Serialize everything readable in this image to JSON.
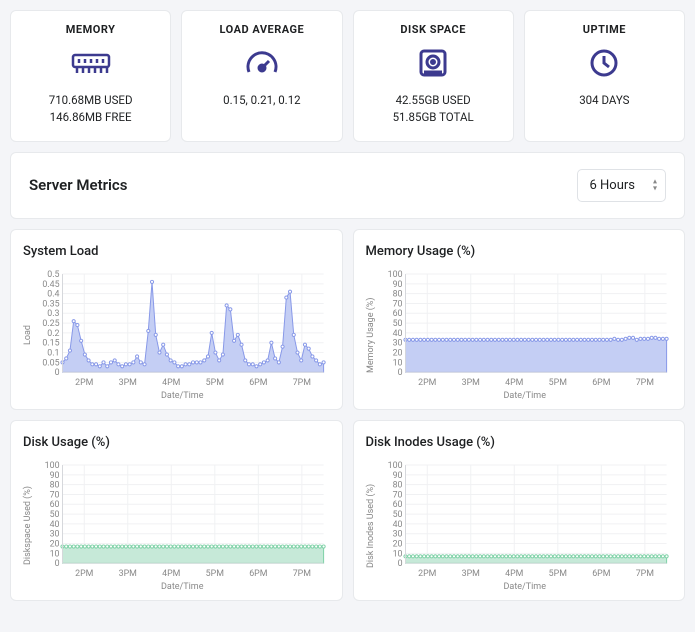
{
  "cards": {
    "memory": {
      "title": "MEMORY",
      "line1": "710.68MB USED",
      "line2": "146.86MB FREE"
    },
    "load": {
      "title": "LOAD AVERAGE",
      "line1": "0.15, 0.21, 0.12"
    },
    "disk": {
      "title": "DISK SPACE",
      "line1": "42.55GB USED",
      "line2": "51.85GB TOTAL"
    },
    "uptime": {
      "title": "UPTIME",
      "line1": "304 DAYS"
    }
  },
  "metrics": {
    "title": "Server Metrics",
    "range": "6 Hours"
  },
  "charts": {
    "system_load": {
      "title": "System Load",
      "ylabel": "Load",
      "xlabel": "Date/Time"
    },
    "memory_usage": {
      "title": "Memory Usage (%)",
      "ylabel": "Memory Usage (%)",
      "xlabel": "Date/Time"
    },
    "disk_usage": {
      "title": "Disk Usage (%)",
      "ylabel": "Diskspace Used (%)",
      "xlabel": "Date/Time"
    },
    "inode_usage": {
      "title": "Disk Inodes Usage (%)",
      "ylabel": "Disk Inodes Used (%)",
      "xlabel": "Date/Time"
    }
  },
  "chart_data": [
    {
      "id": "system_load",
      "type": "line",
      "title": "System Load",
      "xlabel": "Date/Time",
      "ylabel": "Load",
      "ylim": [
        0,
        0.5
      ],
      "yticks": [
        0,
        0.05,
        0.1,
        0.15,
        0.2,
        0.25,
        0.3,
        0.35,
        0.4,
        0.45,
        0.5
      ],
      "xticks": [
        "2PM",
        "3PM",
        "4PM",
        "5PM",
        "6PM",
        "7PM"
      ],
      "values": [
        0.05,
        0.07,
        0.11,
        0.26,
        0.24,
        0.16,
        0.09,
        0.06,
        0.04,
        0.04,
        0.03,
        0.05,
        0.03,
        0.05,
        0.06,
        0.04,
        0.03,
        0.04,
        0.04,
        0.05,
        0.08,
        0.05,
        0.04,
        0.21,
        0.46,
        0.19,
        0.1,
        0.14,
        0.09,
        0.06,
        0.05,
        0.03,
        0.03,
        0.04,
        0.04,
        0.05,
        0.05,
        0.05,
        0.06,
        0.08,
        0.2,
        0.1,
        0.06,
        0.09,
        0.34,
        0.32,
        0.16,
        0.19,
        0.14,
        0.06,
        0.04,
        0.04,
        0.03,
        0.04,
        0.05,
        0.06,
        0.15,
        0.07,
        0.05,
        0.13,
        0.38,
        0.41,
        0.19,
        0.1,
        0.06,
        0.14,
        0.12,
        0.08,
        0.06,
        0.04,
        0.05
      ]
    },
    {
      "id": "memory_usage",
      "type": "line",
      "title": "Memory Usage (%)",
      "xlabel": "Date/Time",
      "ylabel": "Memory Usage (%)",
      "ylim": [
        0,
        100
      ],
      "yticks": [
        0,
        10,
        20,
        30,
        40,
        50,
        60,
        70,
        80,
        90,
        100
      ],
      "xticks": [
        "2PM",
        "3PM",
        "4PM",
        "5PM",
        "6PM",
        "7PM"
      ],
      "values": [
        33,
        33,
        33,
        33,
        33,
        33,
        33,
        33,
        33,
        33,
        33,
        33,
        33,
        33,
        33,
        33,
        33,
        33,
        33,
        33,
        33,
        33,
        33,
        33,
        33,
        33,
        33,
        33,
        33,
        33,
        33,
        33,
        33,
        33,
        33,
        33,
        33,
        33,
        33,
        33,
        33,
        33,
        33,
        33,
        33,
        33,
        33,
        33,
        33,
        33,
        33,
        33,
        33,
        33,
        33,
        33,
        34,
        33,
        33,
        34,
        35,
        35,
        33,
        34,
        34,
        34,
        35,
        35,
        34,
        34,
        34
      ]
    },
    {
      "id": "disk_usage",
      "type": "line",
      "title": "Disk Usage (%)",
      "xlabel": "Date/Time",
      "ylabel": "Diskspace Used (%)",
      "ylim": [
        0,
        100
      ],
      "yticks": [
        0,
        10,
        20,
        30,
        40,
        50,
        60,
        70,
        80,
        90,
        100
      ],
      "xticks": [
        "2PM",
        "3PM",
        "4PM",
        "5PM",
        "6PM",
        "7PM"
      ],
      "values": [
        17,
        17,
        17,
        17,
        17,
        17,
        17,
        17,
        17,
        17,
        17,
        17,
        17,
        17,
        17,
        17,
        17,
        17,
        17,
        17,
        17,
        17,
        17,
        17,
        17,
        17,
        17,
        17,
        17,
        17,
        17,
        17,
        17,
        17,
        17,
        17,
        17,
        17,
        17,
        17,
        17,
        17,
        17,
        17,
        17,
        17,
        17,
        17,
        17,
        17,
        17,
        17,
        17,
        17,
        17,
        17,
        17,
        17,
        17,
        17,
        17,
        17,
        17,
        17,
        17,
        17,
        17,
        17,
        17,
        17,
        17
      ]
    },
    {
      "id": "inode_usage",
      "type": "line",
      "title": "Disk Inodes Usage (%)",
      "xlabel": "Date/Time",
      "ylabel": "Disk Inodes Used (%)",
      "ylim": [
        0,
        100
      ],
      "yticks": [
        0,
        10,
        20,
        30,
        40,
        50,
        60,
        70,
        80,
        90,
        100
      ],
      "xticks": [
        "2PM",
        "3PM",
        "4PM",
        "5PM",
        "6PM",
        "7PM"
      ],
      "values": [
        7,
        7,
        7,
        7,
        7,
        7,
        7,
        7,
        7,
        7,
        7,
        7,
        7,
        7,
        7,
        7,
        7,
        7,
        7,
        7,
        7,
        7,
        7,
        7,
        7,
        7,
        7,
        7,
        7,
        7,
        7,
        7,
        7,
        7,
        7,
        7,
        7,
        7,
        7,
        7,
        7,
        7,
        7,
        7,
        7,
        7,
        7,
        7,
        7,
        7,
        7,
        7,
        7,
        7,
        7,
        7,
        7,
        7,
        7,
        7,
        7,
        7,
        7,
        7,
        7,
        7,
        7,
        7,
        7,
        7,
        7
      ]
    }
  ]
}
